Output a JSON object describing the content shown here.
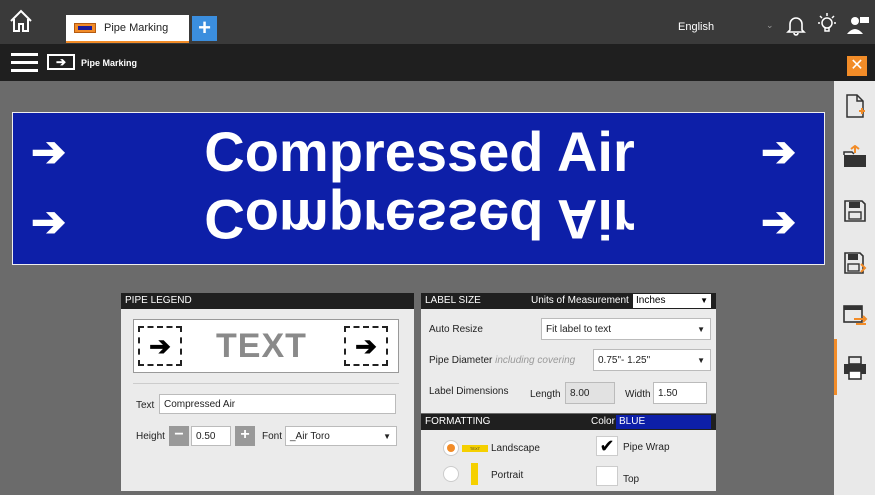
{
  "topbar": {
    "tab_label": "Pipe Marking",
    "language": "English"
  },
  "secbar": {
    "title": "Pipe Marking"
  },
  "preview": {
    "text": "Compressed Air",
    "arrow": "➔",
    "background_color": "#0d1fa8",
    "text_color": "#ffffff"
  },
  "legend": {
    "header": "PIPE LEGEND",
    "sample_text": "TEXT",
    "sample_arrow": "➔",
    "text_label": "Text",
    "text_value": "Compressed Air",
    "height_label": "Height",
    "height_value": "0.50",
    "minus": "−",
    "plus": "+",
    "font_label": "Font",
    "font_value": "_Air Toro"
  },
  "label_size": {
    "header": "LABEL SIZE",
    "units_label": "Units of Measurement",
    "units_value": "Inches",
    "auto_resize_label": "Auto Resize",
    "auto_resize_value": "Fit label to text",
    "pipe_diameter_label": "Pipe Diameter",
    "pipe_diameter_note": "including covering",
    "pipe_diameter_value": "0.75\"- 1.25\"",
    "dimensions_label": "Label Dimensions",
    "length_label": "Length",
    "length_value": "8.00",
    "width_label": "Width",
    "width_value": "1.50"
  },
  "formatting": {
    "header": "FORMATTING",
    "color_label": "Color",
    "color_value": "BLUE",
    "landscape_label": "Landscape",
    "landscape_selected": true,
    "portrait_label": "Portrait",
    "portrait_selected": false,
    "pipe_wrap_label": "Pipe Wrap",
    "pipe_wrap_checked": true,
    "top_label": "Top",
    "top_checked": false,
    "tag_text": "TEXT"
  },
  "colors": {
    "accent": "#f28c28",
    "label_blue": "#0d1fa8",
    "add_button": "#3b8ede"
  }
}
